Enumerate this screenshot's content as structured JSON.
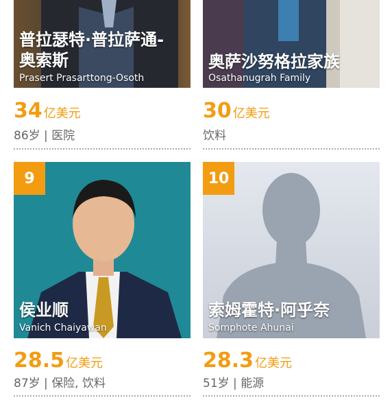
{
  "entries": [
    {
      "rank": "",
      "name_cn_1": "普拉瑟特·普拉萨通-",
      "name_cn_2": "奥索斯",
      "name_en": "Prasert Prasarttong-Osoth",
      "value_num": "34",
      "value_unit": "亿美元",
      "age": "86岁",
      "industry": "医院"
    },
    {
      "rank": "",
      "name_cn_1": "",
      "name_cn_2": "奥萨沙努格拉家族",
      "name_en": "Osathanugrah Family",
      "value_num": "30",
      "value_unit": "亿美元",
      "age": "",
      "industry": "饮料"
    },
    {
      "rank": "9",
      "name_cn_1": "",
      "name_cn_2": "侯业顺",
      "name_en": "Vanich Chaiyawan",
      "value_num": "28.5",
      "value_unit": "亿美元",
      "age": "87岁",
      "industry": "保险, 饮料"
    },
    {
      "rank": "10",
      "name_cn_1": "",
      "name_cn_2": "索姆霍特·阿乎奈",
      "name_en": "Somphote Ahunai",
      "value_num": "28.3",
      "value_unit": "亿美元",
      "age": "51岁",
      "industry": "能源"
    }
  ],
  "separator": " | ",
  "colors": {
    "accent": "#f39c12",
    "photo_teal": "#1f8a96",
    "placeholder_bg": "#d3d8df"
  }
}
